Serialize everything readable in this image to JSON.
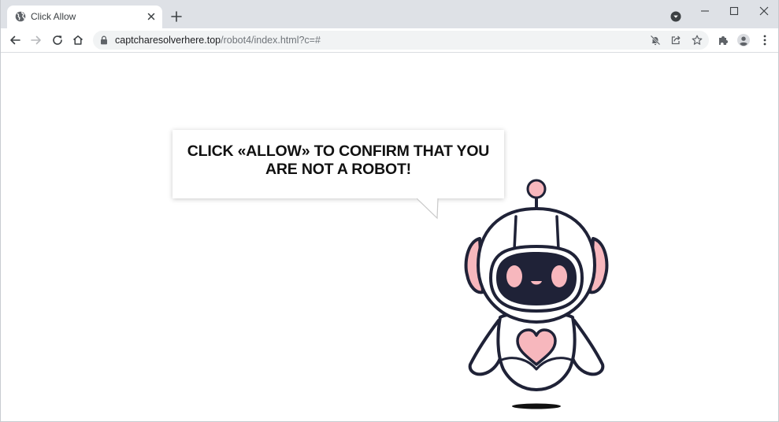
{
  "browser": {
    "tab": {
      "title": "Click Allow",
      "favicon": "globe-icon"
    },
    "address_bar": {
      "host": "captcharesolverhere.top",
      "path": "/robot4/index.html?c=#"
    },
    "icons": {
      "back": "arrow-left-icon",
      "forward": "arrow-right-icon",
      "reload": "reload-icon",
      "home": "home-icon",
      "lock": "lock-icon",
      "notifications_blocked": "bell-off-icon",
      "share": "share-icon",
      "bookmark": "star-icon",
      "extensions": "puzzle-icon",
      "profile": "avatar-icon",
      "menu": "kebab-menu-icon"
    }
  },
  "page": {
    "message_line1": "CLICK «ALLOW» TO CONFIRM THAT YOU",
    "message_line2": "ARE NOT A ROBOT!"
  },
  "colors": {
    "robot_outline": "#1f2237",
    "robot_accent": "#f7b7bd",
    "tab_strip": "#dee1e6",
    "omnibox": "#f1f3f4"
  }
}
